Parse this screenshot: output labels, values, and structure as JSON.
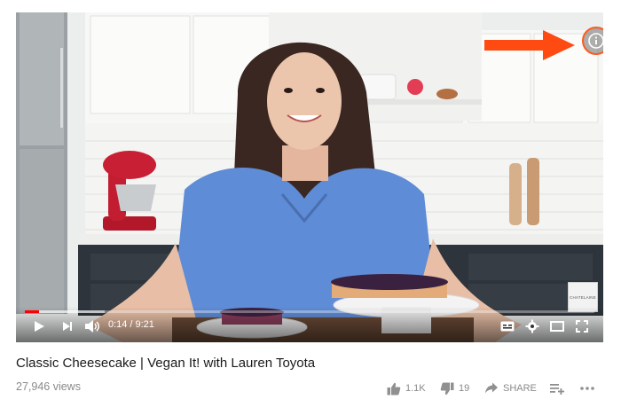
{
  "player": {
    "current_time": "0:14",
    "separator": "/",
    "duration": "9:21",
    "progress_fraction": 0.025,
    "buffered_fraction": 0.14,
    "watermark_text": "CHATELAINE",
    "info_icon": "info-icon",
    "annotation_arrow_color": "#ff4a12"
  },
  "video": {
    "title": "Classic Cheesecake | Vegan It! with Lauren Toyota",
    "views": "27,946 views"
  },
  "actions": {
    "like_count": "1.1K",
    "dislike_count": "19",
    "share_label": "SHARE"
  },
  "colors": {
    "progress": "#ff0000",
    "accent_circle": "#ff5a1f",
    "text_primary": "#1a1a1a",
    "text_secondary": "#8a8a8a"
  }
}
